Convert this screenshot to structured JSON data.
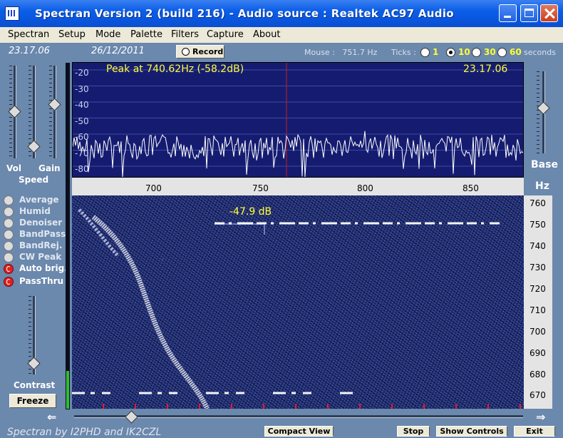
{
  "window": {
    "title": "Spectran Version 2 (build 216) - Audio source  :  Realtek AC97 Audio"
  },
  "menu": [
    "Spectran",
    "Setup",
    "Mode",
    "Palette",
    "Filters",
    "Capture",
    "About"
  ],
  "info": {
    "time": "23.17.06",
    "date": "26/12/2011",
    "record_label": "Record",
    "mouse_label": "Mouse :",
    "mouse_value": "751.7 Hz",
    "ticks_label": "Ticks :",
    "ticks_options": [
      "1",
      "10",
      "30",
      "60"
    ],
    "ticks_selected": "10",
    "seconds_label": "seconds"
  },
  "left_panel": {
    "vol_label": "Vol",
    "gain_label": "Gain",
    "speed_label": "Speed",
    "contrast_label": "Contrast",
    "freeze_label": "Freeze",
    "options": [
      {
        "label": "Average",
        "on": false
      },
      {
        "label": "Humid",
        "on": false
      },
      {
        "label": "Denoiser",
        "on": false
      },
      {
        "label": "BandPass",
        "on": false
      },
      {
        "label": "BandRej.",
        "on": false
      },
      {
        "label": "CW Peak",
        "on": false
      },
      {
        "label": "Auto brig.",
        "on": true
      },
      {
        "label": "PassThru",
        "on": true
      }
    ]
  },
  "spectrum": {
    "peak_text": "Peak at  740.62Hz (-58.2dB)",
    "time": "23.17.06",
    "db_ticks": [
      "-20",
      "-30",
      "-40",
      "-50",
      "-60",
      "-70",
      "-80"
    ],
    "x_ticks": [
      "700",
      "750",
      "800",
      "850"
    ]
  },
  "waterfall": {
    "level_text": "-47.9 dB",
    "y_ticks": [
      "760",
      "750",
      "740",
      "730",
      "720",
      "710",
      "700",
      "690",
      "680",
      "670"
    ],
    "hz_label": "Hz",
    "base_label": "Base"
  },
  "bottom": {
    "credits": "Spectran  by I2PHD and IK2CZL",
    "buttons": [
      "Compact View",
      "Stop",
      "Show Controls",
      "Exit"
    ]
  },
  "colors": {
    "panel": "#6b88ad",
    "spectrum_bg": "#151c70",
    "trace": "#ffffff",
    "marker": "#c81c1c",
    "highlight_text": "#ffff33"
  }
}
